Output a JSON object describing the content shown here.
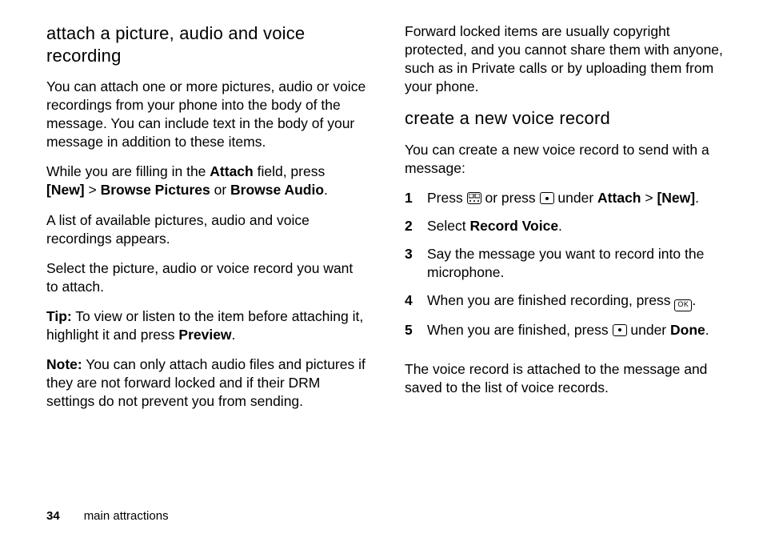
{
  "left": {
    "h1": "attach a picture, audio and voice recording",
    "p1": "You can attach one or more pictures, audio or voice recordings from your phone into the body of the message. You can include text in the body of your message in addition to these items.",
    "p2a": "While you are filling in the ",
    "p2_attach": "Attach",
    "p2b": " field, press ",
    "p2_new": "[New]",
    "p2c": " > ",
    "p2_bp": "Browse Pictures",
    "p2d": " or ",
    "p2_ba": "Browse Audio",
    "p2e": ".",
    "p3": "A list of available pictures, audio and voice recordings appears.",
    "p4": "Select the picture, audio or voice record you want to attach.",
    "tip_label": "Tip:",
    "tip_a": " To view or listen to the item before attaching it, highlight it and press ",
    "tip_preview": "Preview",
    "tip_b": ".",
    "note_label": "Note:",
    "note_body": " You can only attach audio files and pictures if they are not forward locked and if their DRM settings do not prevent you from sending."
  },
  "right": {
    "p0": "Forward locked items are usually copyright protected, and you cannot share them with anyone, such as in Private calls or by uploading them from your phone.",
    "h2": "create a new voice record",
    "p1": "You can create a new voice record to send with a message:",
    "s1a": "Press ",
    "s1b": " or press ",
    "s1c": " under ",
    "s1_attach": "Attach",
    "s1d": " > ",
    "s1_new": "[New]",
    "s1e": ".",
    "s2a": "Select ",
    "s2_rv": "Record Voice",
    "s2b": ".",
    "s3": "Say the message you want to record into the microphone.",
    "s4a": "When you are finished recording, press ",
    "s4b": ".",
    "s5a": "When you are finished, press ",
    "s5b": " under ",
    "s5_done": "Done",
    "s5c": ".",
    "p_end": "The voice record is attached to the message and saved to the list of voice records.",
    "ok_label": "OK"
  },
  "footer": {
    "page": "34",
    "section": "main attractions"
  }
}
